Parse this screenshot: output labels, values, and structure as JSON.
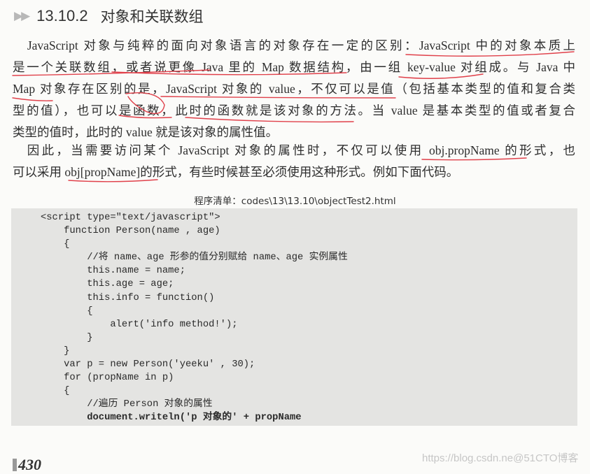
{
  "heading": {
    "marker": "▶▶",
    "number": "13.10.2",
    "title": "对象和关联数组"
  },
  "paragraph1": [
    "　JavaScript 对象与纯粹的面向对象语言的对象存在一定的区别：JavaScript 中的对象本质上",
    "是一个关联数组，或者说更像 Java 里的 Map 数据结构，由一组 key-value 对组成。与 Java 中",
    "Map 对象存在区别的是，JavaScript 对象的 value，不仅可以是值（包括基本类型的值和复合类",
    "型的值），也可以是函数，此时的函数就是该对象的方法。当 value 是基本类型的值或者复合",
    "类型的值时，此时的 value 就是该对象的属性值。"
  ],
  "paragraph2": [
    "　因此，当需要访问某个 JavaScript 对象的属性时，不仅可以使用 obj.propName 的形式，也",
    "可以采用 obj[propName]的形式，有些时候甚至必须使用这种形式。例如下面代码。"
  ],
  "listing_caption": "程序清单：codes\\13\\13.10\\objectTest2.html",
  "code_lines": [
    "<script type=\"text/javascript\">",
    "    function Person(name , age)",
    "    {",
    "        //将 name、age 形参的值分别赋给 name、age 实例属性",
    "        this.name = name;",
    "        this.age = age;",
    "        this.info = function()",
    "        {",
    "            alert('info method!');",
    "        }",
    "    }",
    "    var p = new Person('yeeku' , 30);",
    "    for (propName in p)",
    "    {",
    "        //遍历 Person 对象的属性",
    "        document.writeln('p 对象的' + propName"
  ],
  "page_number": "430",
  "watermark": "https://blog.csdn.ne@51CTO博客",
  "annotation_color": "#e0404a"
}
